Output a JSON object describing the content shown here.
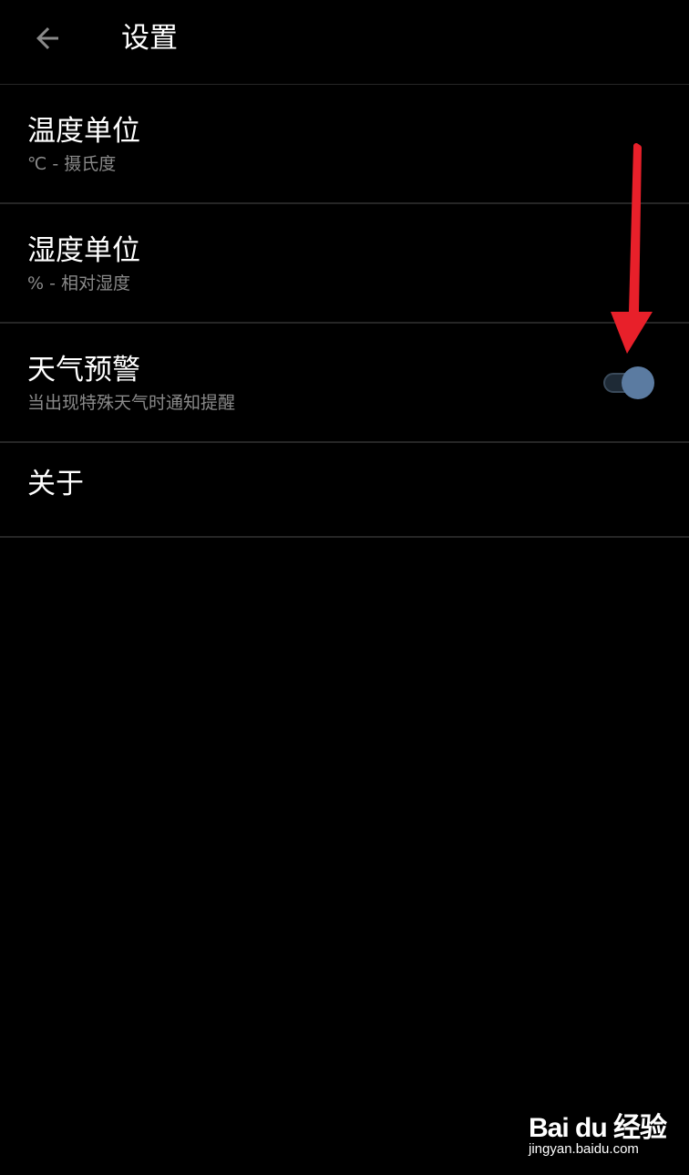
{
  "app_bar": {
    "title": "设置",
    "back_icon": "arrow-left-icon"
  },
  "settings": [
    {
      "title": "温度单位",
      "summary": "℃ - 摄氏度"
    },
    {
      "title": "湿度单位",
      "summary": "% - 相对湿度"
    },
    {
      "title": "天气预警",
      "summary": "当出现特殊天气时通知提醒",
      "toggle": true
    },
    {
      "title": "关于"
    }
  ],
  "colors": {
    "background": "#000000",
    "divider": "#262626",
    "title_text": "#ffffff",
    "summary_text": "#8a8a8a",
    "switch_thumb": "#5b7ba1",
    "annotation_arrow": "#e8202a"
  },
  "watermark": {
    "logo": "Bai du 经验",
    "url": "jingyan.baidu.com"
  }
}
